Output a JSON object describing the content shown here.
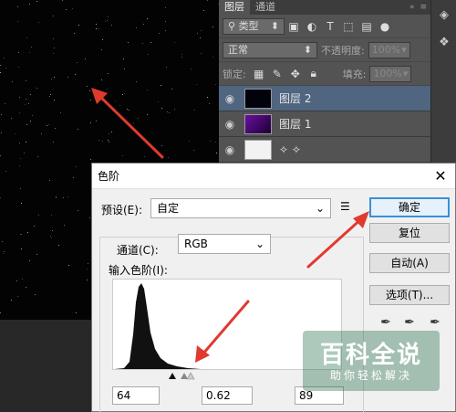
{
  "layers_panel": {
    "tabs": [
      "图层",
      "通道"
    ],
    "filter_label": "类型",
    "blend_mode": "正常",
    "opacity_label": "不透明度:",
    "opacity_value": "100%",
    "lock_label": "锁定:",
    "fill_label": "填充:",
    "fill_value": "100%",
    "layers": [
      {
        "name": "图层 2",
        "thumb_color": "#02020c",
        "selected": true
      },
      {
        "name": "图层 1",
        "thumb_color": "#5a0a8a",
        "selected": false
      }
    ]
  },
  "dialog": {
    "title": "色阶",
    "preset_label": "预设(E):",
    "preset_value": "自定",
    "channel_label": "通道(C):",
    "channel_value": "RGB",
    "input_levels_label": "输入色阶(I):",
    "buttons": {
      "ok": "确定",
      "reset": "复位",
      "auto": "自动(A)",
      "options": "选项(T)..."
    },
    "input_values": {
      "black": "64",
      "gamma": "0.62",
      "white": "89"
    }
  },
  "watermark": {
    "main": "百科全说",
    "sub": "助你轻松解决"
  },
  "colors": {
    "canvas_bg": "#030303",
    "panel_bg": "#535353",
    "selected_layer": "#4f6580",
    "dialog_bg": "#f0f0f0",
    "primary_button_border": "#3c8fd6",
    "arrow": "#e03a2f"
  }
}
